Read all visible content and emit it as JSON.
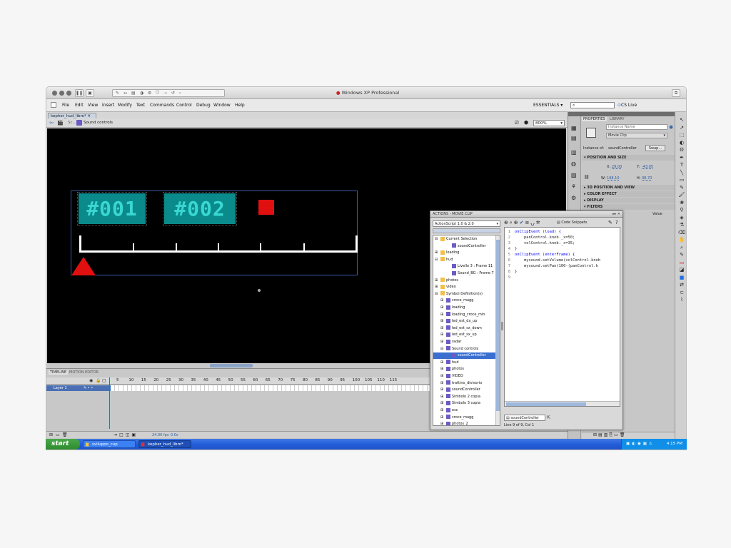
{
  "window": {
    "title": "Windows XP Professional"
  },
  "menu": [
    "File",
    "Edit",
    "View",
    "Insert",
    "Modify",
    "Text",
    "Commands",
    "Control",
    "Debug",
    "Window",
    "Help"
  ],
  "workspace": "ESSENTIALS",
  "cs_live": "CS Live",
  "search_placeholder": "",
  "document_tab": "kepher_hud_libro*",
  "breadcrumb": "Sound controls",
  "zoom": "800%",
  "stage": {
    "label_1": "#001",
    "label_2": "#002",
    "accent_teal": "#0a8a8a",
    "accent_red": "#e01010"
  },
  "timeline": {
    "tabs": [
      "TIMELINE",
      "MOTION EDITOR"
    ],
    "layer_name": "Layer 1",
    "frame_numbers": [
      "5",
      "10",
      "15",
      "20",
      "25",
      "30",
      "35",
      "40",
      "45",
      "50",
      "55",
      "60",
      "65",
      "70",
      "75",
      "80",
      "85",
      "90",
      "95",
      "100",
      "105",
      "110",
      "115"
    ],
    "status_fps": "24.00 fps",
    "status_time": "0.0s"
  },
  "properties": {
    "tabs": [
      "PROPERTIES",
      "LIBRARY"
    ],
    "instance_name_placeholder": "Instance Name",
    "symbol_type": "Movie Clip",
    "instance_of_label": "Instance of:",
    "instance_of_value": "soundController",
    "swap_button": "Swap...",
    "position_header": "POSITION AND SIZE",
    "x_label": "X:",
    "x_value": "29.00",
    "y_label": "Y:",
    "y_value": "-43.05",
    "w_label": "W:",
    "w_value": "198.10",
    "h_label": "H:",
    "h_value": "38.70",
    "sections": [
      "3D POSITION AND VIEW",
      "COLOR EFFECT",
      "DISPLAY",
      "FILTERS"
    ],
    "value_header": "Value"
  },
  "actions": {
    "title": "ACTIONS - MOVIE CLIP",
    "version": "ActionScript 1.0 & 2.0",
    "code_snippets": "Code Snippets",
    "tree": [
      {
        "label": "Current Selection",
        "indent": 0,
        "expand": "-"
      },
      {
        "label": "soundController",
        "indent": 2,
        "expand": ""
      },
      {
        "label": "loading",
        "indent": 0,
        "expand": "+"
      },
      {
        "label": "hud",
        "indent": 0,
        "expand": "-"
      },
      {
        "label": "Livello 3 : Frame 11",
        "indent": 2,
        "expand": ""
      },
      {
        "label": "Sound_BG : Frame 7",
        "indent": 2,
        "expand": ""
      },
      {
        "label": "photos",
        "indent": 0,
        "expand": "+"
      },
      {
        "label": "video",
        "indent": 0,
        "expand": "+"
      },
      {
        "label": "Symbol Definition(s)",
        "indent": 0,
        "expand": "-"
      },
      {
        "label": "croce_magg",
        "indent": 1,
        "expand": "+"
      },
      {
        "label": "loading",
        "indent": 1,
        "expand": "+"
      },
      {
        "label": "loading_croce_min",
        "indent": 1,
        "expand": "+"
      },
      {
        "label": "led_est_dx_up",
        "indent": 1,
        "expand": "+"
      },
      {
        "label": "led_est_sx_down",
        "indent": 1,
        "expand": "+"
      },
      {
        "label": "led_est_sx_up",
        "indent": 1,
        "expand": "+"
      },
      {
        "label": "radar",
        "indent": 1,
        "expand": "+"
      },
      {
        "label": "Sound controls",
        "indent": 1,
        "expand": "-"
      },
      {
        "label": "soundController",
        "indent": 2,
        "expand": "",
        "selected": true
      },
      {
        "label": "hud",
        "indent": 1,
        "expand": "+"
      },
      {
        "label": "photos",
        "indent": 1,
        "expand": "+"
      },
      {
        "label": "VIDEO",
        "indent": 1,
        "expand": "+"
      },
      {
        "label": "trattino_divisorio",
        "indent": 1,
        "expand": "+"
      },
      {
        "label": "soundController",
        "indent": 1,
        "expand": "+"
      },
      {
        "label": "Simbolo 2 copia",
        "indent": 1,
        "expand": "+"
      },
      {
        "label": "Simbolo 3 copia",
        "indent": 1,
        "expand": "+"
      },
      {
        "label": "esc",
        "indent": 1,
        "expand": "+"
      },
      {
        "label": "croce_magg",
        "indent": 1,
        "expand": "+"
      },
      {
        "label": "photos_2",
        "indent": 1,
        "expand": "+"
      }
    ],
    "code": [
      {
        "n": "1",
        "text": "onClipEvent (load) {"
      },
      {
        "n": "2",
        "text": "    panControl.knob._x=50;"
      },
      {
        "n": "3",
        "text": "    volControl.knob._x=35;"
      },
      {
        "n": "4",
        "text": "}"
      },
      {
        "n": "5",
        "text": "onClipEvent (enterFrame) {"
      },
      {
        "n": "6",
        "text": "    mysound.setVolume(volControl.knob"
      },
      {
        "n": "7",
        "text": "    mysound.setPan(100-(panControl.k"
      },
      {
        "n": "8",
        "text": "}"
      },
      {
        "n": "9",
        "text": ""
      }
    ],
    "script_tab": "soundController",
    "status": "Line 9 of 9, Col 1"
  },
  "taskbar": {
    "start": "start",
    "tasks": [
      "sviluppo_cup",
      "kepher_hud_libro*"
    ],
    "clock": "4:15 PM"
  }
}
